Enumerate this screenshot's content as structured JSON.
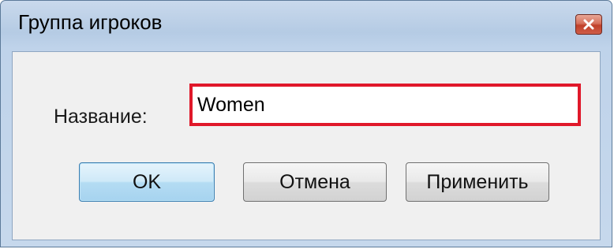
{
  "window": {
    "title": "Группа игроков",
    "close_icon": "close-x-icon"
  },
  "form": {
    "name_label": "Название:",
    "name_value": "Women"
  },
  "buttons": {
    "ok": "OK",
    "cancel": "Отмена",
    "apply": "Применить"
  },
  "colors": {
    "highlight_border": "#e0182a",
    "default_button_border": "#3c7fb1",
    "close_button": "#c0402a"
  }
}
